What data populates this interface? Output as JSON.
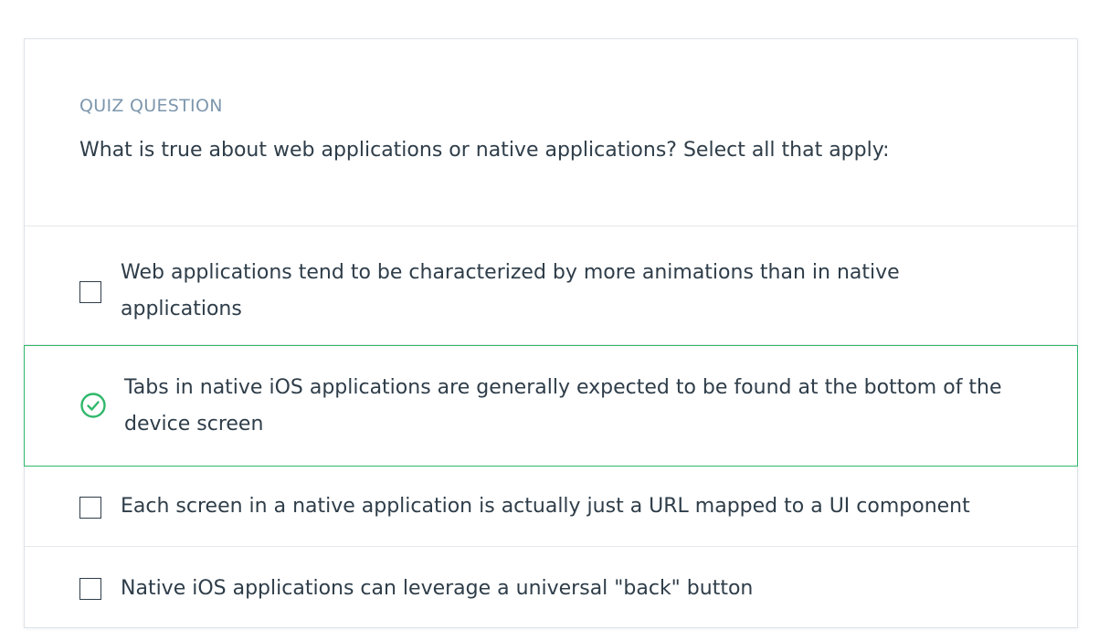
{
  "quiz": {
    "eyebrow": "QUIZ QUESTION",
    "question": "What is true about web applications or native applications? Select all that apply:",
    "options": [
      {
        "label": "Web applications tend to be characterized by more animations than in native applications",
        "selected": false
      },
      {
        "label": "Tabs in native iOS applications are generally expected to be found at the bottom of the device screen",
        "selected": true
      },
      {
        "label": "Each screen in a native application is actually just a URL mapped to a UI component",
        "selected": false
      },
      {
        "label": "Native iOS applications can leverage a universal \"back\" button",
        "selected": false
      }
    ]
  },
  "colors": {
    "accent_correct": "#2fb86a",
    "eyebrow": "#7d97ad",
    "text": "#2e3d49"
  },
  "icons": {
    "selected": "check-circle-icon",
    "unselected": "checkbox-icon"
  }
}
